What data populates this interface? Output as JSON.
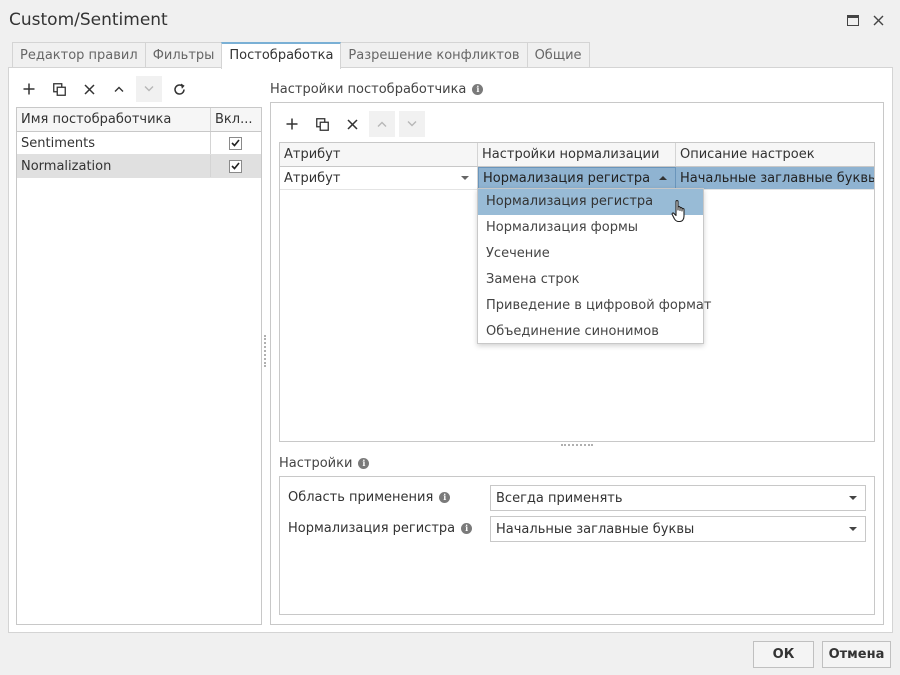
{
  "window": {
    "title": "Custom/Sentiment"
  },
  "tabs": [
    {
      "label": "Редактор правил"
    },
    {
      "label": "Фильтры"
    },
    {
      "label": "Постобработка"
    },
    {
      "label": "Разрешение конфликтов"
    },
    {
      "label": "Общие"
    }
  ],
  "left_grid": {
    "columns": [
      "Имя постобработчика",
      "Вкл..."
    ],
    "rows": [
      {
        "name": "Sentiments",
        "enabled": true
      },
      {
        "name": "Normalization",
        "enabled": true
      }
    ]
  },
  "postprocessor_settings": {
    "label": "Настройки постобработчика",
    "columns": [
      "Атрибут",
      "Настройки нормализации",
      "Описание настроек"
    ],
    "row": {
      "attribute": "Атрибут",
      "normalization": "Нормализация регистра",
      "description": "Начальные заглавные буквы"
    },
    "dropdown_options": [
      "Нормализация регистра",
      "Нормализация формы",
      "Усечение",
      "Замена строк",
      "Приведение в цифровой формат",
      "Объединение синонимов"
    ]
  },
  "settings": {
    "label": "Настройки",
    "fields": [
      {
        "label": "Область применения",
        "value": "Всегда применять"
      },
      {
        "label": "Нормализация регистра",
        "value": "Начальные заглавные буквы"
      }
    ]
  },
  "footer": {
    "ok_label": "ОК",
    "cancel_label": "Отмена"
  },
  "colors": {
    "selection": "#8fb3d1",
    "active_tab_accent": "#7ab0d5"
  }
}
